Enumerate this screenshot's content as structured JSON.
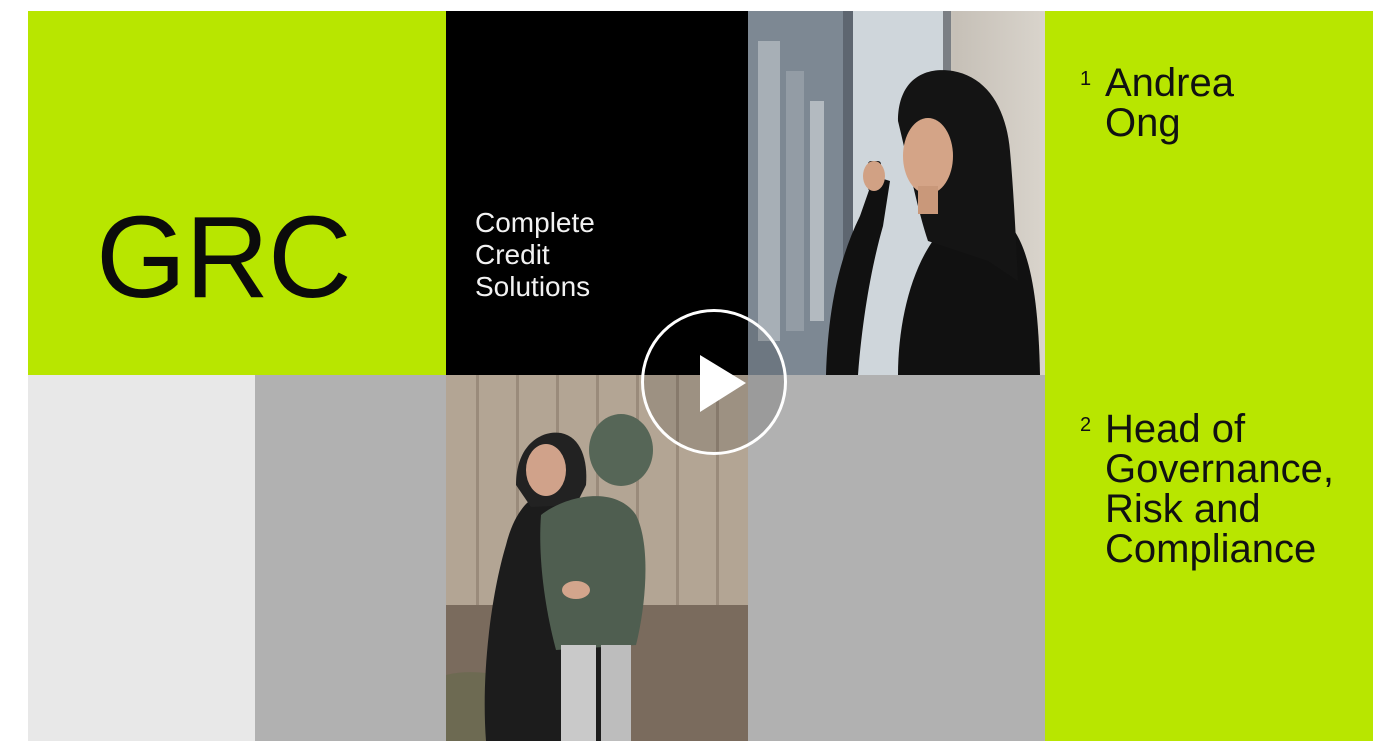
{
  "header": {
    "logo_text": "GRC",
    "company": "Complete\nCredit\nSolutions"
  },
  "captions": [
    {
      "number": "1",
      "text": "Andrea\nOng"
    },
    {
      "number": "2",
      "text": "Head of\nGovernance,\nRisk and\nCompliance"
    }
  ],
  "player": {
    "play_icon": "play-icon"
  },
  "colors": {
    "accent": "#b8e600",
    "dark": "#000000",
    "gray": "#b1b1b1",
    "light": "#e8e8e8"
  }
}
